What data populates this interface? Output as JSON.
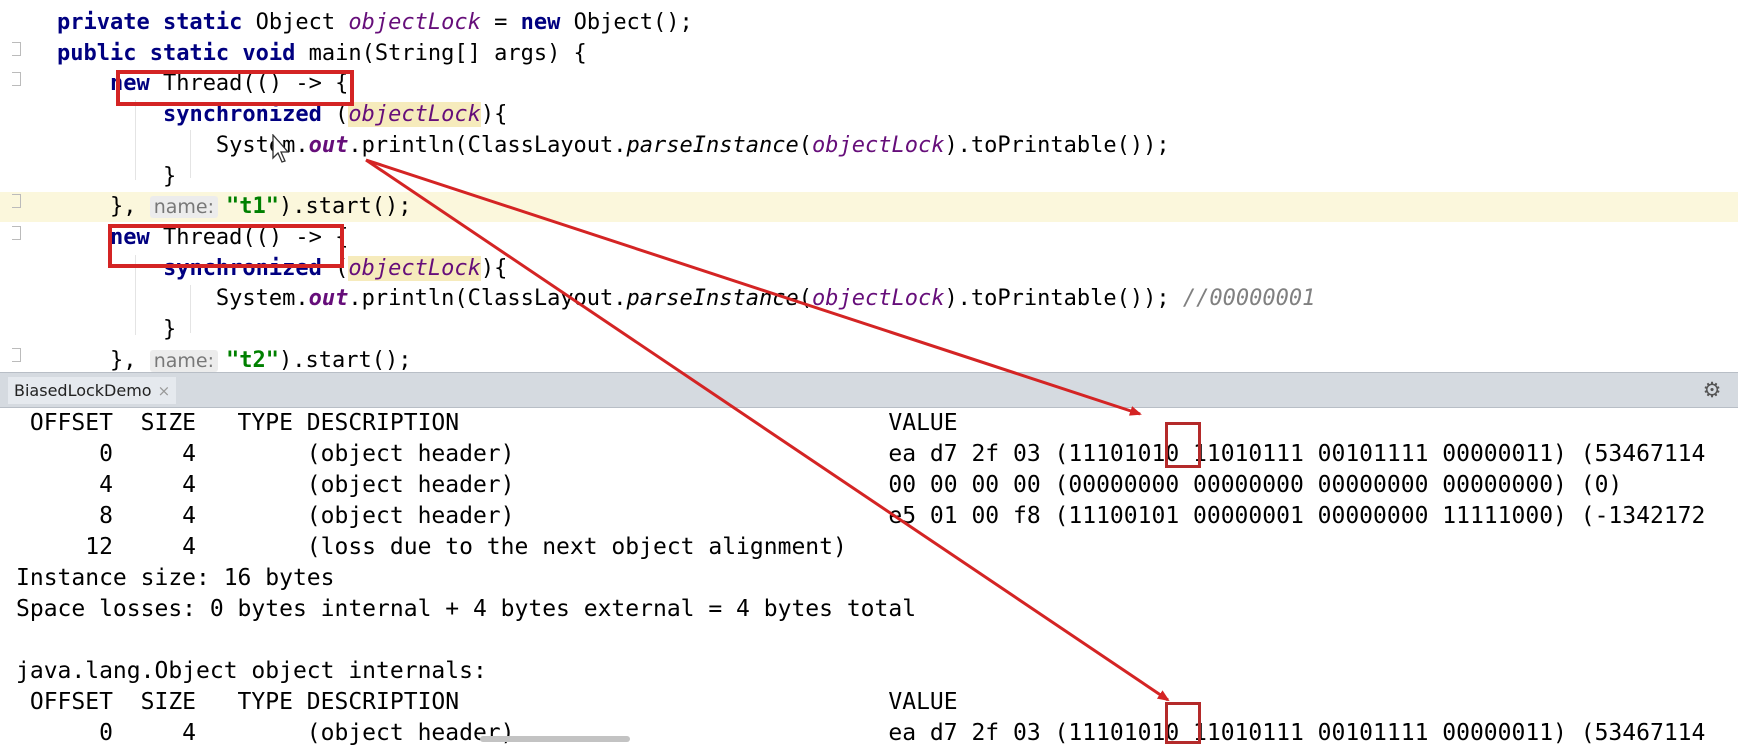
{
  "editor": {
    "lines": [
      [
        {
          "t": "    "
        },
        {
          "t": "private static ",
          "c": "kw"
        },
        {
          "t": "Object "
        },
        {
          "t": "objectLock",
          "c": "it"
        },
        {
          "t": " = "
        },
        {
          "t": "new ",
          "c": "kw"
        },
        {
          "t": "Object();"
        }
      ],
      [
        {
          "t": "    "
        },
        {
          "t": "public static void ",
          "c": "kw"
        },
        {
          "t": "main(String[] args) {"
        }
      ],
      [
        {
          "t": "        "
        },
        {
          "t": "new ",
          "c": "kw"
        },
        {
          "t": "Thread(() -> {"
        }
      ],
      [
        {
          "t": "            "
        },
        {
          "t": "synchronized ",
          "c": "kw"
        },
        {
          "t": "("
        },
        {
          "t": "objectLock",
          "c": "it lockbg"
        },
        {
          "t": "){"
        }
      ],
      [
        {
          "t": "                System."
        },
        {
          "t": "out",
          "c": "sf"
        },
        {
          "t": ".println(ClassLayout."
        },
        {
          "t": "parseInstance",
          "c": "mi"
        },
        {
          "t": "("
        },
        {
          "t": "objectLock",
          "c": "it"
        },
        {
          "t": ").toPrintable());"
        }
      ],
      [
        {
          "t": "            }"
        }
      ],
      [
        {
          "t": "        }, "
        },
        {
          "t": "name:",
          "c": "hint"
        },
        {
          "t": "\"t1\"",
          "c": "str"
        },
        {
          "t": ").start();"
        }
      ],
      [
        {
          "t": "        "
        },
        {
          "t": "new ",
          "c": "kw"
        },
        {
          "t": "Thread(() -> {"
        }
      ],
      [
        {
          "t": "            "
        },
        {
          "t": "synchronized ",
          "c": "kw"
        },
        {
          "t": "("
        },
        {
          "t": "objectLock",
          "c": "it lockbg"
        },
        {
          "t": "){"
        }
      ],
      [
        {
          "t": "                System."
        },
        {
          "t": "out",
          "c": "sf"
        },
        {
          "t": ".println(ClassLayout."
        },
        {
          "t": "parseInstance",
          "c": "mi"
        },
        {
          "t": "("
        },
        {
          "t": "objectLock",
          "c": "it"
        },
        {
          "t": ").toPrintable()); "
        },
        {
          "t": "//00000001",
          "c": "cm"
        }
      ],
      [
        {
          "t": "            }"
        }
      ],
      [
        {
          "t": "        }, "
        },
        {
          "t": "name:",
          "c": "hint"
        },
        {
          "t": "\"t2\"",
          "c": "str"
        },
        {
          "t": ").start();"
        }
      ]
    ],
    "highlighted_line": 6
  },
  "tool_window": {
    "tab_label": "BiasedLockDemo",
    "close_glyph": "×",
    "settings_glyph": "⚙"
  },
  "console": {
    "lines": [
      " OFFSET  SIZE   TYPE DESCRIPTION                               VALUE",
      "      0     4        (object header)                           ea d7 2f 03 (11101010 11010111 00101111 00000011) (53467114",
      "      4     4        (object header)                           00 00 00 00 (00000000 00000000 00000000 00000000) (0)",
      "      8     4        (object header)                           e5 01 00 f8 (11100101 00000001 00000000 11111000) (-1342172",
      "     12     4        (loss due to the next object alignment)",
      "Instance size: 16 bytes",
      "Space losses: 0 bytes internal + 4 bytes external = 4 bytes total",
      "",
      "java.lang.Object object internals:",
      " OFFSET  SIZE   TYPE DESCRIPTION                               VALUE",
      "      0     4        (object header)                           ea d7 2f 03 (11101010 11010111 00101111 00000011) (53467114"
    ]
  },
  "colors": {
    "annotation_red": "#d42424",
    "keyword": "#000080",
    "string": "#008000",
    "highlight_line": "#fbf7dc"
  }
}
